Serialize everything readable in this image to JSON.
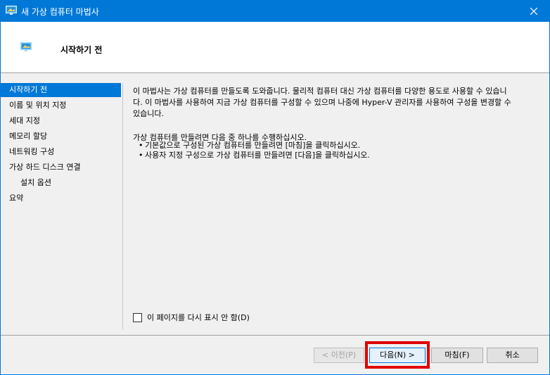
{
  "window": {
    "title": "새 가상 컴퓨터 마법사",
    "close_icon": "close-icon"
  },
  "header": {
    "title": "시작하기 전",
    "icon": "monitor-icon"
  },
  "nav": {
    "items": [
      {
        "label": "시작하기 전",
        "active": true
      },
      {
        "label": "이름 및 위치 지정"
      },
      {
        "label": "세대 지정"
      },
      {
        "label": "메모리 할당"
      },
      {
        "label": "네트워킹 구성"
      },
      {
        "label": "가상 하드 디스크 연결"
      },
      {
        "label": "설치 옵션",
        "sub": true
      },
      {
        "label": "요약"
      }
    ]
  },
  "content": {
    "para1_line1": "이 마법사는 가상 컴퓨터를 만들도록 도와줍니다. 물리적 컴퓨터 대신 가상 컴퓨터를 다양한 용도로 사용할 수 있습니",
    "para1_line2": "다. 이 마법사를 사용하여 지금 가상 컴퓨터를 구성할 수 있으며 나중에 Hyper-V 관리자를 사용하여 구성을 변경할 수",
    "para1_line3": "있습니다.",
    "para2": "가상 컴퓨터를 만들려면 다음 중 하나를 수행하십시오.",
    "bullets": [
      "기본값으로 구성된 가상 컴퓨터를 만들려면 [마침]을 클릭하십시오.",
      "사용자 지정 구성으로 가상 컴퓨터를 만들려면 [다음]을 클릭하십시오."
    ],
    "checkbox_label": "이 페이지를 다시 표시 안 함(D)",
    "checkbox_checked": false
  },
  "buttons": {
    "prev": "< 이전(P)",
    "next": "다음(N) >",
    "finish": "마침(F)",
    "cancel": "취소"
  },
  "colors": {
    "accent": "#0078d7",
    "highlight": "#e00000"
  }
}
